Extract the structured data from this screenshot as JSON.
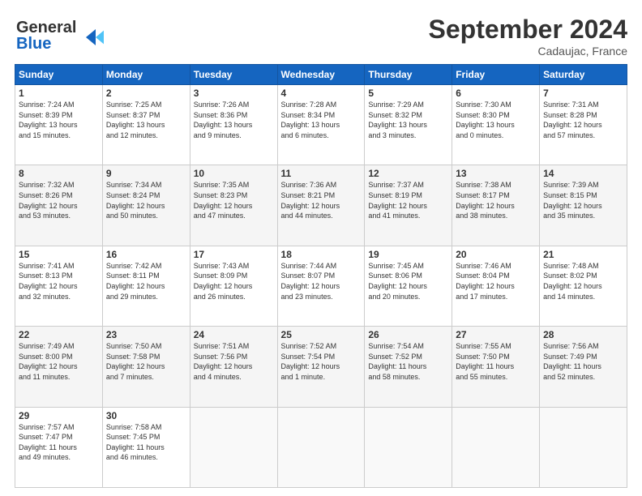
{
  "header": {
    "logo_line1": "General",
    "logo_line2": "Blue",
    "month_title": "September 2024",
    "location": "Cadaujac, France"
  },
  "weekdays": [
    "Sunday",
    "Monday",
    "Tuesday",
    "Wednesday",
    "Thursday",
    "Friday",
    "Saturday"
  ],
  "weeks": [
    [
      {
        "day": "1",
        "info": "Sunrise: 7:24 AM\nSunset: 8:39 PM\nDaylight: 13 hours\nand 15 minutes."
      },
      {
        "day": "2",
        "info": "Sunrise: 7:25 AM\nSunset: 8:37 PM\nDaylight: 13 hours\nand 12 minutes."
      },
      {
        "day": "3",
        "info": "Sunrise: 7:26 AM\nSunset: 8:36 PM\nDaylight: 13 hours\nand 9 minutes."
      },
      {
        "day": "4",
        "info": "Sunrise: 7:28 AM\nSunset: 8:34 PM\nDaylight: 13 hours\nand 6 minutes."
      },
      {
        "day": "5",
        "info": "Sunrise: 7:29 AM\nSunset: 8:32 PM\nDaylight: 13 hours\nand 3 minutes."
      },
      {
        "day": "6",
        "info": "Sunrise: 7:30 AM\nSunset: 8:30 PM\nDaylight: 13 hours\nand 0 minutes."
      },
      {
        "day": "7",
        "info": "Sunrise: 7:31 AM\nSunset: 8:28 PM\nDaylight: 12 hours\nand 57 minutes."
      }
    ],
    [
      {
        "day": "8",
        "info": "Sunrise: 7:32 AM\nSunset: 8:26 PM\nDaylight: 12 hours\nand 53 minutes."
      },
      {
        "day": "9",
        "info": "Sunrise: 7:34 AM\nSunset: 8:24 PM\nDaylight: 12 hours\nand 50 minutes."
      },
      {
        "day": "10",
        "info": "Sunrise: 7:35 AM\nSunset: 8:23 PM\nDaylight: 12 hours\nand 47 minutes."
      },
      {
        "day": "11",
        "info": "Sunrise: 7:36 AM\nSunset: 8:21 PM\nDaylight: 12 hours\nand 44 minutes."
      },
      {
        "day": "12",
        "info": "Sunrise: 7:37 AM\nSunset: 8:19 PM\nDaylight: 12 hours\nand 41 minutes."
      },
      {
        "day": "13",
        "info": "Sunrise: 7:38 AM\nSunset: 8:17 PM\nDaylight: 12 hours\nand 38 minutes."
      },
      {
        "day": "14",
        "info": "Sunrise: 7:39 AM\nSunset: 8:15 PM\nDaylight: 12 hours\nand 35 minutes."
      }
    ],
    [
      {
        "day": "15",
        "info": "Sunrise: 7:41 AM\nSunset: 8:13 PM\nDaylight: 12 hours\nand 32 minutes."
      },
      {
        "day": "16",
        "info": "Sunrise: 7:42 AM\nSunset: 8:11 PM\nDaylight: 12 hours\nand 29 minutes."
      },
      {
        "day": "17",
        "info": "Sunrise: 7:43 AM\nSunset: 8:09 PM\nDaylight: 12 hours\nand 26 minutes."
      },
      {
        "day": "18",
        "info": "Sunrise: 7:44 AM\nSunset: 8:07 PM\nDaylight: 12 hours\nand 23 minutes."
      },
      {
        "day": "19",
        "info": "Sunrise: 7:45 AM\nSunset: 8:06 PM\nDaylight: 12 hours\nand 20 minutes."
      },
      {
        "day": "20",
        "info": "Sunrise: 7:46 AM\nSunset: 8:04 PM\nDaylight: 12 hours\nand 17 minutes."
      },
      {
        "day": "21",
        "info": "Sunrise: 7:48 AM\nSunset: 8:02 PM\nDaylight: 12 hours\nand 14 minutes."
      }
    ],
    [
      {
        "day": "22",
        "info": "Sunrise: 7:49 AM\nSunset: 8:00 PM\nDaylight: 12 hours\nand 11 minutes."
      },
      {
        "day": "23",
        "info": "Sunrise: 7:50 AM\nSunset: 7:58 PM\nDaylight: 12 hours\nand 7 minutes."
      },
      {
        "day": "24",
        "info": "Sunrise: 7:51 AM\nSunset: 7:56 PM\nDaylight: 12 hours\nand 4 minutes."
      },
      {
        "day": "25",
        "info": "Sunrise: 7:52 AM\nSunset: 7:54 PM\nDaylight: 12 hours\nand 1 minute."
      },
      {
        "day": "26",
        "info": "Sunrise: 7:54 AM\nSunset: 7:52 PM\nDaylight: 11 hours\nand 58 minutes."
      },
      {
        "day": "27",
        "info": "Sunrise: 7:55 AM\nSunset: 7:50 PM\nDaylight: 11 hours\nand 55 minutes."
      },
      {
        "day": "28",
        "info": "Sunrise: 7:56 AM\nSunset: 7:49 PM\nDaylight: 11 hours\nand 52 minutes."
      }
    ],
    [
      {
        "day": "29",
        "info": "Sunrise: 7:57 AM\nSunset: 7:47 PM\nDaylight: 11 hours\nand 49 minutes."
      },
      {
        "day": "30",
        "info": "Sunrise: 7:58 AM\nSunset: 7:45 PM\nDaylight: 11 hours\nand 46 minutes."
      },
      {
        "day": "",
        "info": ""
      },
      {
        "day": "",
        "info": ""
      },
      {
        "day": "",
        "info": ""
      },
      {
        "day": "",
        "info": ""
      },
      {
        "day": "",
        "info": ""
      }
    ]
  ]
}
